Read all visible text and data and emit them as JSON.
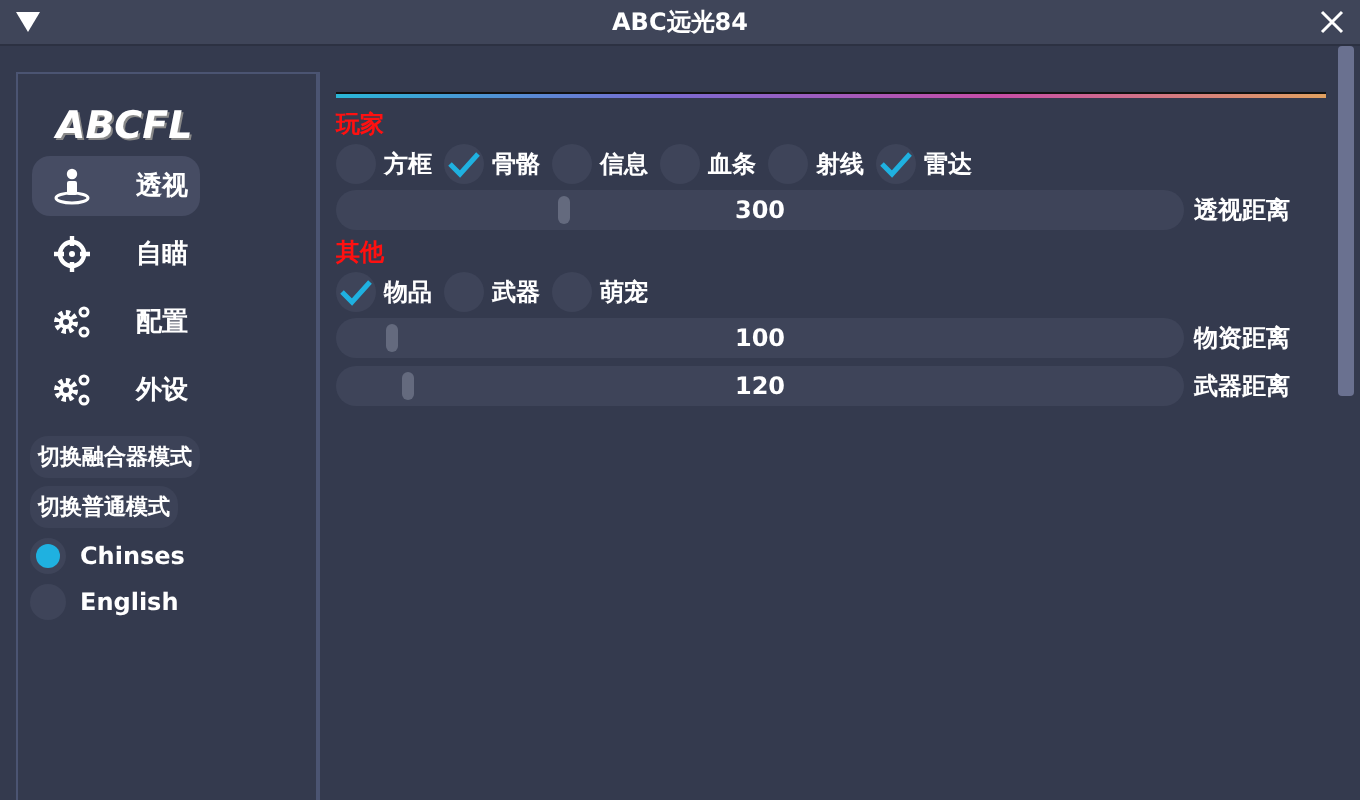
{
  "window": {
    "title": "ABC远光84"
  },
  "sidebar": {
    "logo": "ABCFL",
    "items": [
      {
        "label": "透视",
        "kind": "person",
        "selected": true
      },
      {
        "label": "自瞄",
        "kind": "crosshair",
        "selected": false
      },
      {
        "label": "配置",
        "kind": "gears",
        "selected": false
      },
      {
        "label": "外设",
        "kind": "gears",
        "selected": false
      }
    ],
    "mode_buttons": [
      "切换融合器模式",
      "切换普通模式"
    ],
    "languages": [
      {
        "label": "Chinses",
        "selected": true
      },
      {
        "label": "English",
        "selected": false
      }
    ]
  },
  "sections": [
    {
      "title": "玩家",
      "checkboxes": [
        {
          "label": "方框",
          "checked": false
        },
        {
          "label": "骨骼",
          "checked": true
        },
        {
          "label": "信息",
          "checked": false
        },
        {
          "label": "血条",
          "checked": false
        },
        {
          "label": "射线",
          "checked": false
        },
        {
          "label": "雷达",
          "checked": true
        }
      ],
      "sliders": [
        {
          "value": "300",
          "label": "透视距离",
          "level": 0.27
        }
      ]
    },
    {
      "title": "其他",
      "checkboxes": [
        {
          "label": "物品",
          "checked": true
        },
        {
          "label": "武器",
          "checked": false
        },
        {
          "label": "萌宠",
          "checked": false
        }
      ],
      "sliders": [
        {
          "value": "100",
          "label": "物资距离",
          "level": 0.065
        },
        {
          "value": "120",
          "label": "武器距离",
          "level": 0.085
        }
      ]
    }
  ]
}
